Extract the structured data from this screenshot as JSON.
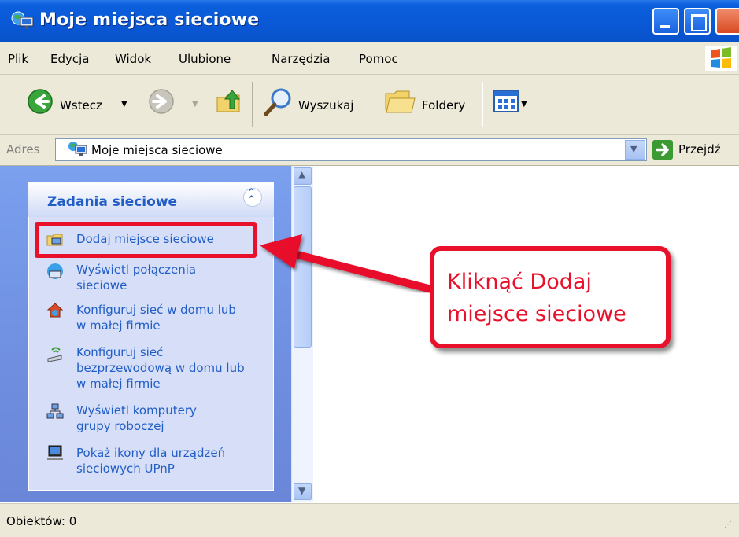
{
  "window": {
    "title": "Moje miejsca sieciowe"
  },
  "menu": [
    {
      "pre": "",
      "u": "P",
      "post": "lik"
    },
    {
      "pre": "",
      "u": "E",
      "post": "dycja"
    },
    {
      "pre": "",
      "u": "W",
      "post": "idok"
    },
    {
      "pre": "",
      "u": "U",
      "post": "lubione"
    },
    {
      "pre": "",
      "u": "N",
      "post": "arzędzia"
    },
    {
      "pre": "Pomo",
      "u": "c",
      "post": ""
    }
  ],
  "toolbar": {
    "back": "Wstecz",
    "search": "Wyszukaj",
    "folders": "Foldery"
  },
  "address": {
    "label": "Adres",
    "value": "Moje miejsca sieciowe",
    "go": "Przejdź"
  },
  "tasks": {
    "title": "Zadania sieciowe",
    "items": [
      "Dodaj miejsce sieciowe",
      "Wyświetl połączenia sieciowe",
      "Konfiguruj sieć w domu lub w małej firmie",
      "Konfiguruj sieć bezprzewodową w domu lub w małej firmie",
      "Wyświetl komputery grupy roboczej",
      "Pokaż ikony dla urządzeń sieciowych UPnP"
    ]
  },
  "status": {
    "text": "Obiektów: 0"
  },
  "annotation": {
    "callout": "Kliknąć Dodaj miejsce sieciowe"
  },
  "colors": {
    "title_bar": "#0a58d6",
    "task_link": "#215dc6",
    "annotation": "#e8102a",
    "chrome": "#ece9d8"
  }
}
